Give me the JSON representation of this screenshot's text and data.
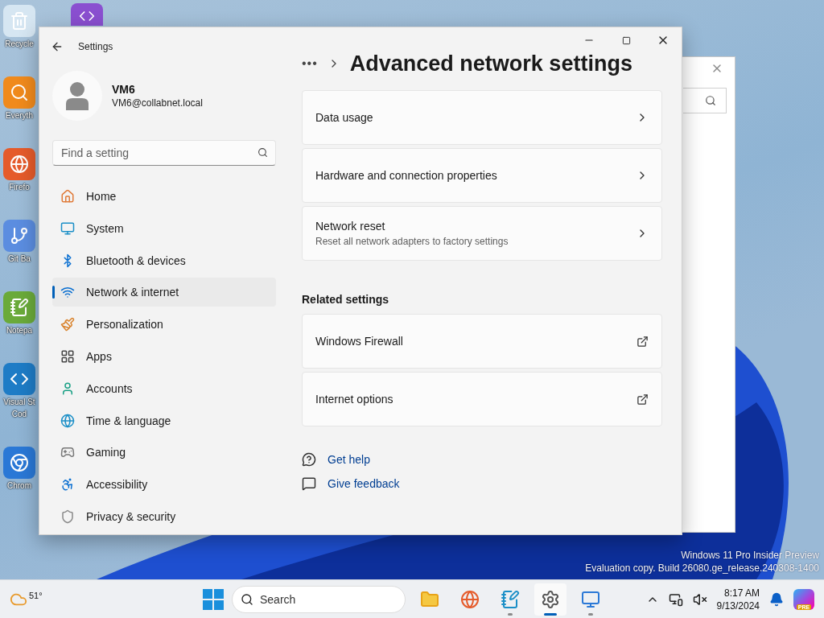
{
  "desktop_icons": [
    {
      "kind": "recycle",
      "lines": [
        "Recycle"
      ]
    },
    {
      "kind": "search",
      "lines": [
        "Everyth"
      ]
    },
    {
      "kind": "firefox",
      "lines": [
        "Firefo"
      ]
    },
    {
      "kind": "git",
      "lines": [
        "Git Ba"
      ]
    },
    {
      "kind": "notepad",
      "lines": [
        "Notepa"
      ]
    },
    {
      "kind": "vscode",
      "lines": [
        "Visual St",
        "Cod"
      ]
    },
    {
      "kind": "chrome",
      "lines": [
        "Chrom"
      ]
    }
  ],
  "desktop_icons_col2": [
    {
      "kind": "vs"
    }
  ],
  "window": {
    "title": "Settings"
  },
  "profile": {
    "name": "VM6",
    "email": "VM6@collabnet.local"
  },
  "search": {
    "placeholder": "Find a setting"
  },
  "nav": [
    {
      "label": "Home",
      "selected": false
    },
    {
      "label": "System",
      "selected": false
    },
    {
      "label": "Bluetooth & devices",
      "selected": false
    },
    {
      "label": "Network & internet",
      "selected": true
    },
    {
      "label": "Personalization",
      "selected": false
    },
    {
      "label": "Apps",
      "selected": false
    },
    {
      "label": "Accounts",
      "selected": false
    },
    {
      "label": "Time & language",
      "selected": false
    },
    {
      "label": "Gaming",
      "selected": false
    },
    {
      "label": "Accessibility",
      "selected": false
    },
    {
      "label": "Privacy & security",
      "selected": false
    }
  ],
  "page": {
    "breadcrumb": "•••",
    "title": "Advanced network settings"
  },
  "cards": [
    {
      "title": "Data usage",
      "kind": "link"
    },
    {
      "title": "Hardware and connection properties",
      "kind": "link"
    },
    {
      "title": "Network reset",
      "subtitle": "Reset all network adapters to factory settings",
      "kind": "link"
    }
  ],
  "related": {
    "heading": "Related settings",
    "cards": [
      {
        "title": "Windows Firewall",
        "kind": "external"
      },
      {
        "title": "Internet options",
        "kind": "external"
      }
    ]
  },
  "help_links": [
    {
      "label": "Get help",
      "kind": "help"
    },
    {
      "label": "Give feedback",
      "kind": "feedback"
    }
  ],
  "watermark": [
    "Windows 11 Pro Insider Preview",
    "Evaluation copy. Build 26080.ge_release.240308-1400"
  ],
  "taskbar": {
    "weather": "51°",
    "search_placeholder": "Search",
    "apps": [
      {
        "kind": "explorer",
        "running": false,
        "selected": false
      },
      {
        "kind": "firefox",
        "running": false,
        "selected": false
      },
      {
        "kind": "notepad",
        "running": true,
        "selected": false
      },
      {
        "kind": "settings",
        "running": true,
        "selected": true
      },
      {
        "kind": "remote",
        "running": true,
        "selected": false
      }
    ],
    "time": "8:17 AM",
    "date": "9/13/2024",
    "copilot_badge": "PRE"
  }
}
